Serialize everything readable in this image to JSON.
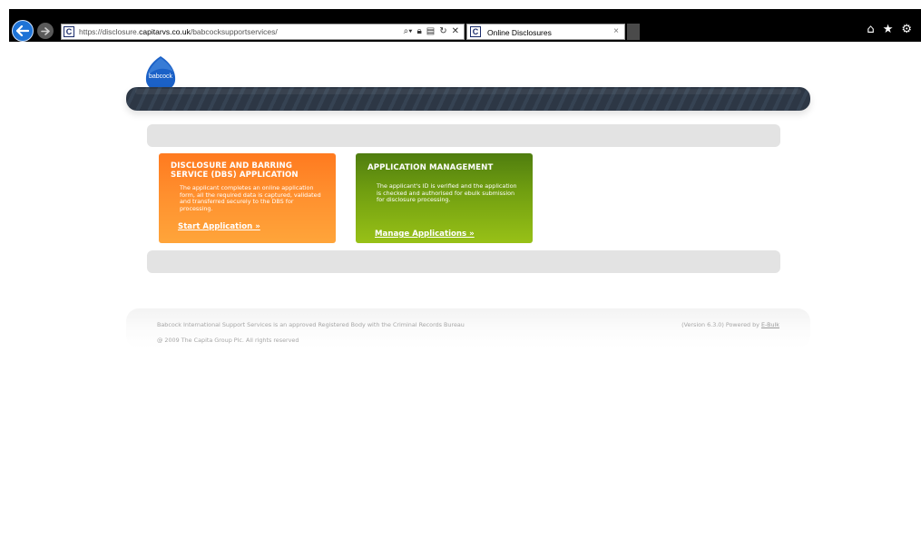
{
  "browser": {
    "address": {
      "url_prefix": "https://disclosure.",
      "url_domain": "capitarvs.co.uk",
      "url_path": "/babcocksupportservices/"
    },
    "tab": {
      "title": "Online Disclosures",
      "close": "×"
    },
    "favicon_letter": "C",
    "icons": [
      "back-arrow-icon",
      "forward-arrow-icon",
      "search-icon",
      "lock-icon",
      "refresh-icon",
      "close-icon",
      "home-icon",
      "star-icon",
      "gear-icon"
    ]
  },
  "header": {
    "logo_text": "babcock"
  },
  "cards": [
    {
      "title": "DISCLOSURE AND BARRING SERVICE (DBS) APPLICATION",
      "description": "The applicant completes an online application form, all the required data is captured, validated and transferred securely to the DBS for processing.",
      "link": "Start Application »",
      "color": "#ff8a28"
    },
    {
      "title": "APPLICATION MANAGEMENT",
      "description": "The applicant's ID is verified and the application is checked and authorised for ebulk submission for disclosure processing.",
      "link": "Manage Applications »",
      "color": "#7da812"
    }
  ],
  "footer": {
    "registered_body_text": "Babcock International Support Services is an approved Registered Body with the Criminal Records Bureau",
    "version_text": "(Version 6.3.0) Powered by ",
    "ebulk_link": "E-Bulk",
    "copyright": "@ 2009 The Capita Group Plc. All rights reserved"
  },
  "colors": {
    "header_bar": "#2d3745",
    "grey_bar": "#e3e3e3",
    "chrome": "#000000",
    "back_button": "#1e73d6"
  }
}
